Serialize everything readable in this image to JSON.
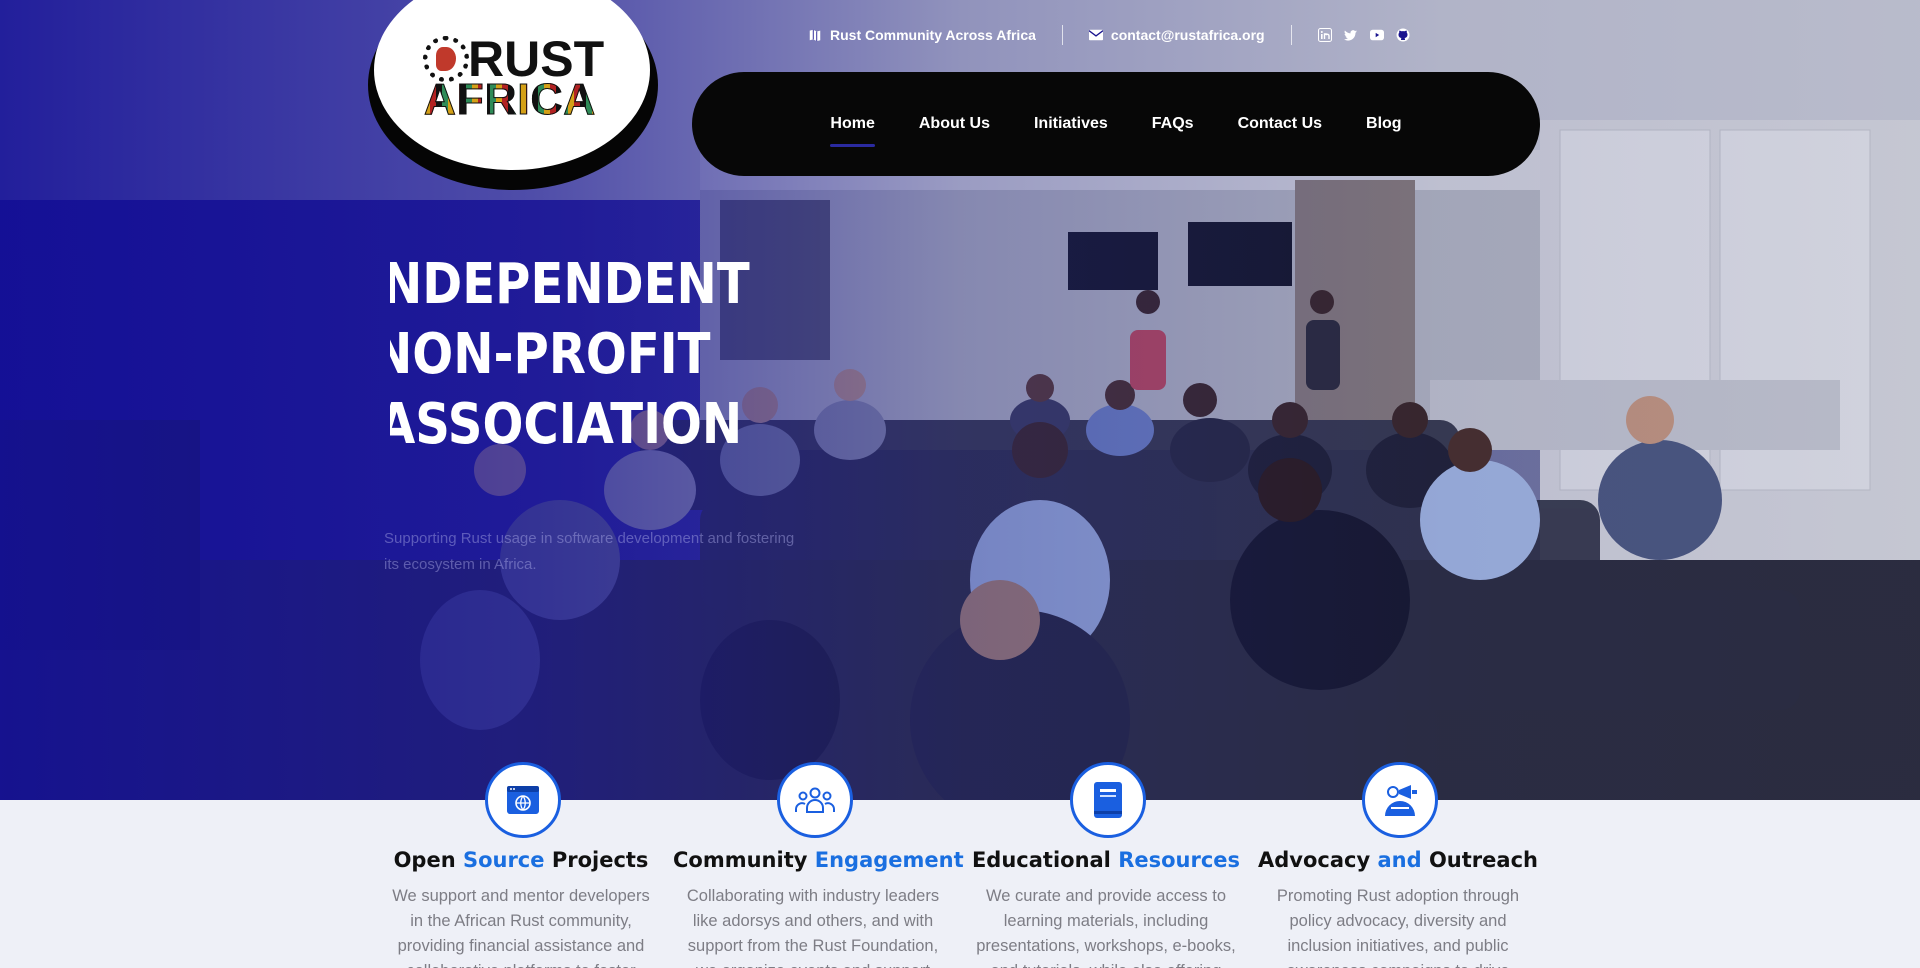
{
  "brand": {
    "logo_line1": "RUST",
    "logo_line2": "AFRICA"
  },
  "topbar": {
    "org_label": "Rust Community Across Africa",
    "email": "contact@rustafrica.org",
    "socials": [
      "linkedin-icon",
      "twitter-icon",
      "youtube-icon",
      "github-icon"
    ]
  },
  "nav": {
    "items": [
      {
        "label": "Home",
        "active": true
      },
      {
        "label": "About Us"
      },
      {
        "label": "Initiatives"
      },
      {
        "label": "FAQs"
      },
      {
        "label": "Contact Us"
      },
      {
        "label": "Blog"
      }
    ]
  },
  "hero": {
    "title_lines": [
      "NDEPENDENT",
      "NON-PROFIT",
      "ASSOCIATION"
    ],
    "subtitle": "Supporting Rust usage in software development and fostering its ecosystem in Africa."
  },
  "features": [
    {
      "icon": "web-globe-icon",
      "title_a": "Open ",
      "title_hl": "Source",
      "title_b": " Projects",
      "text": "We support and mentor developers in the African Rust community, providing financial assistance and collaborative platforms to foster"
    },
    {
      "icon": "community-group-icon",
      "title_a": "Community ",
      "title_hl": "Engagement",
      "title_b": "",
      "text": "Collaborating with industry leaders like adorsys and others, and with support from the Rust Foundation, we organize events and support"
    },
    {
      "icon": "book-icon",
      "title_a": "Educational ",
      "title_hl": "Resources",
      "title_b": "",
      "text": "We curate and provide access to learning materials, including presentations, workshops, e-books, and tutorials, while also offering"
    },
    {
      "icon": "megaphone-icon",
      "title_a": "Advocacy ",
      "title_hl": "and",
      "title_b": " Outreach",
      "text": "Promoting Rust adoption through policy advocacy, diversity and inclusion initiatives, and public awareness campaigns to drive"
    }
  ],
  "colors": {
    "accent": "#1a6fe0",
    "hero_overlay": "#1a148f",
    "nav_bg": "#070707"
  }
}
